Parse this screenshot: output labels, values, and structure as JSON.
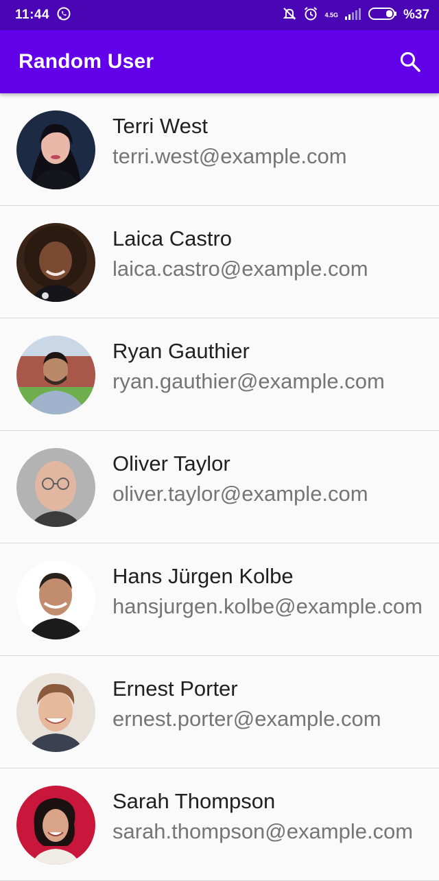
{
  "status_bar": {
    "time": "11:44",
    "network": "4.5G",
    "battery": "%37",
    "icons": [
      "whatsapp-icon",
      "mute-icon",
      "alarm-icon",
      "signal-icon",
      "battery-icon"
    ]
  },
  "app_bar": {
    "title": "Random User",
    "search_icon": "search-icon"
  },
  "colors": {
    "status_bar": "#4a05b5",
    "app_bar": "#6200ea",
    "background": "#fafafa",
    "name_text": "#202020",
    "email_text": "#757575"
  },
  "users": [
    {
      "name": "Terri West",
      "email": "terri.west@example.com"
    },
    {
      "name": "Laica Castro",
      "email": "laica.castro@example.com"
    },
    {
      "name": "Ryan Gauthier",
      "email": "ryan.gauthier@example.com"
    },
    {
      "name": "Oliver Taylor",
      "email": "oliver.taylor@example.com"
    },
    {
      "name": "Hans Jürgen Kolbe",
      "email": "hansjurgen.kolbe@example.com"
    },
    {
      "name": "Ernest Porter",
      "email": "ernest.porter@example.com"
    },
    {
      "name": "Sarah Thompson",
      "email": "sarah.thompson@example.com"
    }
  ]
}
